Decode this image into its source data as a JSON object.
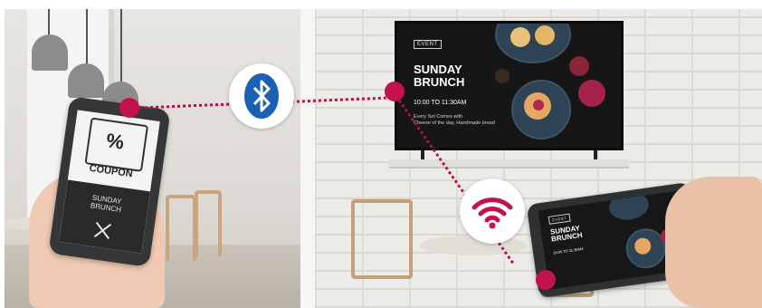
{
  "tv": {
    "tag": "EVENT",
    "title_line1": "SUNDAY",
    "title_line2": "BRUNCH",
    "time": "10:00 TO 11:30AM",
    "desc_line1": "Every Set Comes with",
    "desc_line2": "Cheese of the day, Handmade bread"
  },
  "phone_left": {
    "coupon_symbol": "%",
    "coupon_label": "COUPON",
    "brunch_line1": "SUNDAY",
    "brunch_line2": "BRUNCH"
  },
  "phone_right": {
    "tag": "EVENT",
    "title_line1": "SUNDAY",
    "title_line2": "BRUNCH",
    "time": "10:00 TO 11:30AM"
  },
  "icons": {
    "bluetooth": "bluetooth-icon",
    "wifi": "wifi-icon",
    "coupon": "coupon-ticket-icon",
    "cutlery": "fork-knife-icon"
  },
  "colors": {
    "accent": "#c4124e",
    "bluetooth": "#1a61b4",
    "wifi": "#c4124e"
  }
}
